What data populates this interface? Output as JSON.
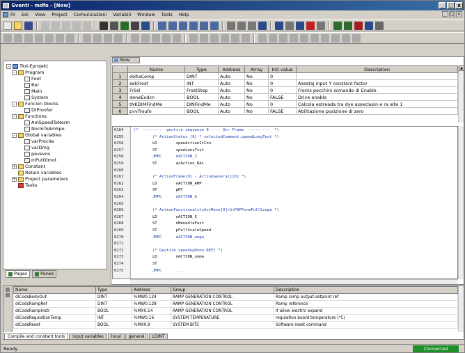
{
  "window": {
    "title": "Eventi - mdfe - [Now]",
    "min": "_",
    "max": "□",
    "close": "x"
  },
  "menu": [
    "Fil",
    "Edi",
    "View",
    "Project",
    "Comunicazioni",
    "Variabili",
    "Window",
    "Tools",
    "Help"
  ],
  "tree": {
    "nodes": [
      {
        "label": "Tkd-Eprojekt",
        "icon": "blue"
      },
      {
        "label": "Program",
        "icon": "folder"
      },
      {
        "label": "Foot",
        "icon": "doc"
      },
      {
        "label": "Ber",
        "icon": "doc"
      },
      {
        "label": "Main",
        "icon": "doc"
      },
      {
        "label": "System",
        "icon": "doc"
      },
      {
        "label": "Funcion blocks",
        "icon": "folder"
      },
      {
        "label": "DtProofer",
        "icon": "doc"
      },
      {
        "label": "Functions",
        "icon": "folder"
      },
      {
        "label": "AmSpeedToNorm",
        "icon": "doc"
      },
      {
        "label": "NormToAmSpo",
        "icon": "doc"
      },
      {
        "label": "Global variables",
        "icon": "folder"
      },
      {
        "label": "varProcite",
        "icon": "doc"
      },
      {
        "label": "varDmg",
        "icon": "doc"
      },
      {
        "label": "pevevns",
        "icon": "doc"
      },
      {
        "label": "InPutOlmot",
        "icon": "doc"
      },
      {
        "label": "Constant",
        "icon": "folder"
      },
      {
        "label": "Retain variables",
        "icon": "folder"
      },
      {
        "label": "Project parameters",
        "icon": "folder"
      },
      {
        "label": "Tasks",
        "icon": "red"
      }
    ]
  },
  "left_tabs": [
    "Pages",
    "Panes"
  ],
  "var_panel": {
    "tab_label": "Now",
    "headers": [
      "",
      "Name",
      "Type",
      "Address",
      "Array",
      "Init value",
      "Description"
    ],
    "rows": [
      [
        "1",
        "deltaComp",
        "DINT",
        "Auto",
        "No",
        "0",
        ""
      ],
      [
        "2",
        "sekFrost",
        "INT",
        "Auto",
        "No",
        "0",
        "Assetaj input Y constant factor"
      ],
      [
        "3",
        "FrSsl",
        "FrostStep",
        "Auto",
        "No",
        "0",
        "Fronts pecchini scmando di Enable"
      ],
      [
        "4",
        "deneExdcn",
        "BOOL",
        "Auto",
        "No",
        "FALSE",
        "Drive enable"
      ],
      [
        "5",
        "tNKDIMFindMe",
        "DINFindMe",
        "Auto",
        "No",
        "0",
        "Calcola estreada tra dye asseclasin e ra alte 1"
      ],
      [
        "6",
        "pvvTroufo",
        "BOOL",
        "Auto",
        "No",
        "FALSE",
        "Abilitazione posizione di zero"
      ]
    ]
  },
  "code": {
    "lines": [
      {
        "num": "0164",
        "text": "(*  --------  gestire sequenze 0 ---- Str Frame  ---------  *)",
        "kind": "cm"
      },
      {
        "num": "0255",
        "text": "        (* ActionStatus [0] * selectedComment.speedLongText *)",
        "kind": "cm"
      },
      {
        "num": "0256",
        "text": "        LD        speeActionItCon",
        "kind": "kw"
      },
      {
        "num": "0257",
        "text": "        ST        speeLonsTsst",
        "kind": "kw"
      },
      {
        "num": "0258",
        "text": "        JMPC      nACTION_Z",
        "kind": "vr"
      },
      {
        "num": "0259",
        "text": "        ST        acAction_RAL",
        "kind": "kw"
      },
      {
        "num": "0260",
        "text": "",
        "kind": "kw"
      },
      {
        "num": "0261",
        "text": "        (* ActionFrame[0] - ActionGenerali[O] *)",
        "kind": "cm"
      },
      {
        "num": "0262",
        "text": "        LD        nACTION_AMP",
        "kind": "kw"
      },
      {
        "num": "0263",
        "text": "        ST        pRT",
        "kind": "kw"
      },
      {
        "num": "0264",
        "text": "        JMPC      nACTION_A",
        "kind": "vr"
      },
      {
        "num": "0265",
        "text": "",
        "kind": "kw"
      },
      {
        "num": "0266",
        "text": "        (* ActionFunctionalityActMove[0]+1+F0FFormFullScope *)",
        "kind": "cm"
      },
      {
        "num": "0267",
        "text": "        LD        nACTION_S",
        "kind": "kw"
      },
      {
        "num": "0268",
        "text": "        ST        nMenedleFast",
        "kind": "kw"
      },
      {
        "num": "0269",
        "text": "        ST        pFullScaleSpeed",
        "kind": "kw"
      },
      {
        "num": "0270",
        "text": "        JMPC      nACTION_enga",
        "kind": "vr"
      },
      {
        "num": "0271",
        "text": "",
        "kind": "kw"
      },
      {
        "num": "0272",
        "text": "        (* Gestire speedupDone REF) *)",
        "kind": "cm"
      },
      {
        "num": "0273",
        "text": "        LD        nACTION_onma",
        "kind": "kw"
      },
      {
        "num": "0274",
        "text": "        ST",
        "kind": "kw"
      },
      {
        "num": "0275",
        "text": "        JMPC      ...",
        "kind": "vr"
      }
    ]
  },
  "bottom": {
    "headers": [
      "Name",
      "Type",
      "Address",
      "Group",
      "Description"
    ],
    "rows": [
      [
        "diCodsBodyOut",
        "DINT",
        "%MW0.124",
        "RAMP GENERATION CONTROL",
        "Ramp ramp output-setpoint ref"
      ],
      [
        "diCodsRampRef",
        "DINT",
        "%MW0.128",
        "RAMP GENERATION CONTROL",
        "Ramp reference"
      ],
      [
        "diCodsRampInstr",
        "BOOL",
        "%MX0.14",
        "RAMP GENERATION CONTROL",
        "If allow electric expand"
      ],
      [
        "diCodsRegulationTemp",
        "INT",
        "%MW0.16",
        "SYSTEM TEMPERATURE",
        "regulation board temperature (°C)"
      ],
      [
        "diCodsReset",
        "BOOL",
        "%MX0.9",
        "SYSTEM BITS",
        "Software reset command"
      ]
    ]
  },
  "bottom_tabs": [
    "Compile and constant tools",
    "input variables",
    "local",
    "general",
    "LDINT"
  ],
  "status": {
    "left": "Ready",
    "badge": "Connected"
  },
  "colors": {
    "title_start": "#0a246a",
    "title_end": "#3a6ea5",
    "status_badge": "#1f8f2a",
    "comment": "#1a3fb0"
  }
}
